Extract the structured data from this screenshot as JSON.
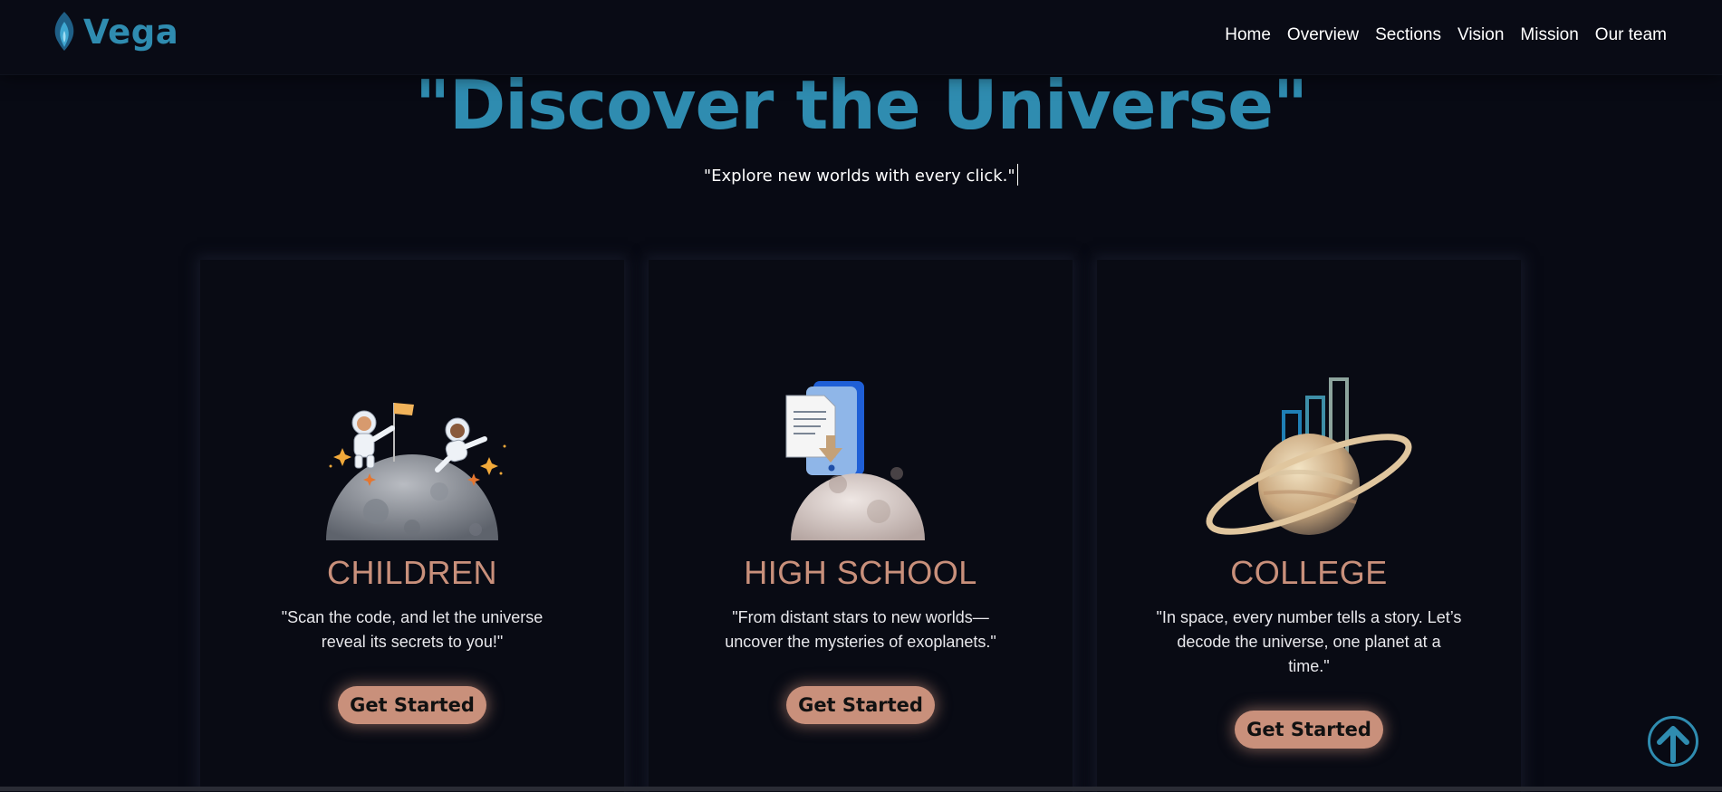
{
  "header": {
    "logo_text": "Vega",
    "nav": [
      "Home",
      "Overview",
      "Sections",
      "Vision",
      "Mission",
      "Our team"
    ]
  },
  "hero": {
    "title": "\"Discover the Universe\"",
    "subtitle": "\"Explore new worlds with every click.\""
  },
  "cards": [
    {
      "title": "CHILDREN",
      "text": "\"Scan the code, and let the universe reveal its secrets to you!\"",
      "button": "Get Started",
      "image_icon": "astronauts-on-moon-icon"
    },
    {
      "title": "HIGH SCHOOL",
      "text": "\"From distant stars to new worlds—uncover the mysteries of exoplanets.\"",
      "button": "Get Started",
      "image_icon": "phone-document-moon-icon"
    },
    {
      "title": "COLLEGE",
      "text": "\"In space, every number tells a story. Let’s decode the universe, one planet at a time.\"",
      "button": "Get Started",
      "image_icon": "saturn-bar-chart-icon"
    }
  ],
  "scroll_top_icon": "arrow-up-circle-icon",
  "colors": {
    "background": "#080a14",
    "brand": "#2f8cb0",
    "accent": "#c9907b",
    "text": "#ffffff"
  }
}
